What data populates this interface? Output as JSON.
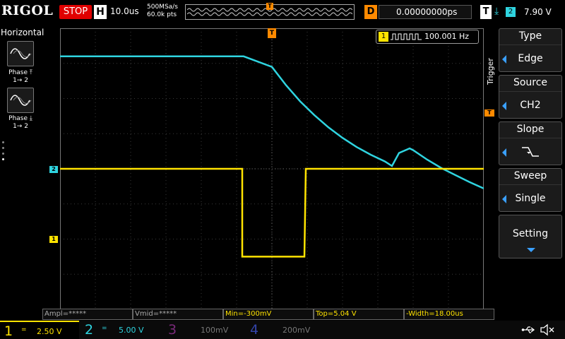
{
  "brand": "RIGOL",
  "run_state": "STOP",
  "timebase": {
    "letter": "H",
    "value": "10.0us",
    "sample_rate": "500MSa/s",
    "points": "60.0k pts"
  },
  "delay": {
    "letter": "D",
    "value": "0.00000000ps"
  },
  "trigger_status": {
    "letter": "T",
    "channel": "2",
    "level": "7.90 V"
  },
  "left_panel": {
    "title": "Horizontal",
    "items": [
      {
        "label_line1": "Phase",
        "label_line2": "1→ 2",
        "icon": "sine-wave-icon",
        "edge": "rising"
      },
      {
        "label_line1": "Phase",
        "label_line2": "1→ 2",
        "icon": "sine-wave-icon",
        "edge": "falling"
      }
    ]
  },
  "markers": {
    "ch1": "1",
    "ch2": "2",
    "trigger_top": "T",
    "trigger_level": "T"
  },
  "frequency": {
    "channel": "1",
    "value": "100.001 Hz"
  },
  "trigger_menu": {
    "label": "Trigger",
    "items": [
      {
        "title": "Type",
        "value": "Edge"
      },
      {
        "title": "Source",
        "value": "CH2"
      },
      {
        "title": "Slope",
        "value": "falling-edge"
      },
      {
        "title": "Sweep",
        "value": "Single"
      },
      {
        "title": "Setting",
        "value": ""
      }
    ]
  },
  "measurements": [
    {
      "text": "Ampl=*****"
    },
    {
      "text": "Vmid=*****"
    },
    {
      "text": "Min=-300mV"
    },
    {
      "text": "Top=5.04 V"
    },
    {
      "text": "-Width=18.00us"
    }
  ],
  "channels": [
    {
      "num": "1",
      "coupling": "=",
      "scale": "2.50 V",
      "color": "#ffe300",
      "active": true
    },
    {
      "num": "2",
      "coupling": "=",
      "scale": "5.00 V",
      "color": "#2fd4e0",
      "active": true
    },
    {
      "num": "3",
      "coupling": "",
      "scale": "100mV",
      "color": "#c040c0",
      "active": false
    },
    {
      "num": "4",
      "coupling": "",
      "scale": "200mV",
      "color": "#4060ff",
      "active": false
    }
  ],
  "status_icons": [
    "usb-icon",
    "speaker-mute-icon"
  ],
  "colors": {
    "ch1": "#ffe300",
    "ch2": "#2fd4e0",
    "trigger": "#ff8a00",
    "stop": "#e00000",
    "menu_arrow": "#3aa0ff"
  },
  "waveforms": {
    "ch2_cyan": {
      "x_us": [
        -30,
        -4,
        0,
        2,
        4,
        6,
        8,
        10,
        12,
        14,
        16,
        17,
        18,
        19.5,
        20,
        22,
        24,
        26,
        28,
        30
      ],
      "y_div": [
        3.2,
        3.2,
        2.9,
        2.38,
        1.92,
        1.53,
        1.18,
        0.88,
        0.62,
        0.4,
        0.21,
        0.08,
        0.45,
        0.58,
        0.53,
        0.26,
        0.02,
        -0.18,
        -0.38,
        -0.56
      ]
    },
    "ch1_yellow": {
      "x_us": [
        -30,
        -4.2,
        -4.2,
        -3.8,
        4.6,
        4.8,
        30
      ],
      "y_div": [
        0,
        0,
        -2.5,
        -2.5,
        -2.5,
        0,
        0
      ]
    }
  }
}
